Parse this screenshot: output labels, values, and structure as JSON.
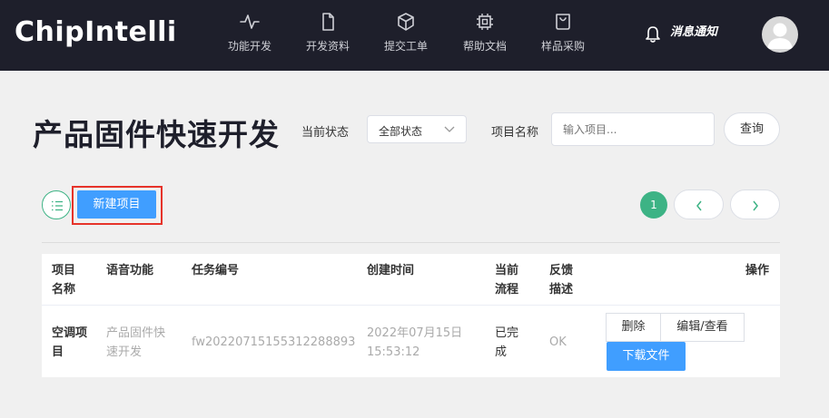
{
  "header": {
    "logo": "ChipIntelli",
    "nav": [
      {
        "label": "功能开发",
        "icon": "pulse-icon"
      },
      {
        "label": "开发资料",
        "icon": "document-icon"
      },
      {
        "label": "提交工单",
        "icon": "cube-icon"
      },
      {
        "label": "帮助文档",
        "icon": "chip-icon"
      },
      {
        "label": "样品采购",
        "icon": "shopping-bag-icon"
      }
    ],
    "notifications_label": "消息通知"
  },
  "page": {
    "title": "产品固件快速开发"
  },
  "filters": {
    "status_label": "当前状态",
    "status_value": "全部状态",
    "name_label": "项目名称",
    "name_placeholder": "输入项目...",
    "query_label": "查询"
  },
  "toolbar": {
    "new_project_label": "新建项目",
    "current_page": "1"
  },
  "table": {
    "headers": [
      "项目\n名称",
      "语音功能",
      "任务编号",
      "创建时间",
      "当前\n流程",
      "反馈\n描述",
      "操作"
    ],
    "rows": [
      {
        "name": "空调项\n目",
        "function": "产品固件快\n速开发",
        "task_id": "fw20220715155312288893",
        "created": "2022年07月15日\n15:53:12",
        "process": "已完\n成",
        "feedback": "OK",
        "actions": {
          "delete": "删除",
          "edit": "编辑/查看",
          "download": "下载文件"
        }
      }
    ]
  },
  "colors": {
    "topbar": "#1e1f2b",
    "accent_green": "#3db385",
    "primary_blue": "#409eff",
    "highlight_red": "#e6332a"
  }
}
